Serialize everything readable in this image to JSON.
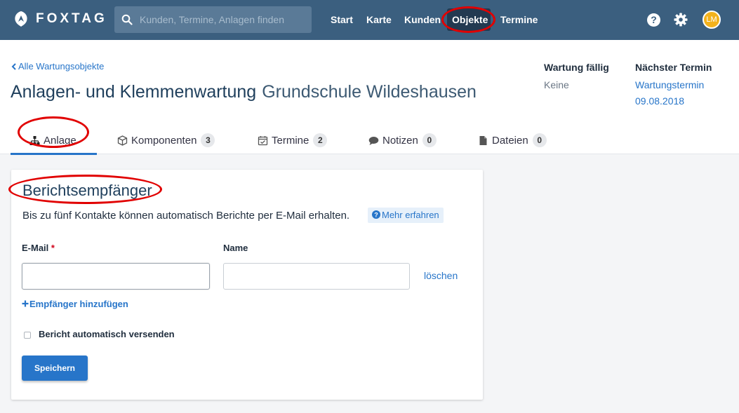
{
  "brand": {
    "name": "FOXTAG"
  },
  "search": {
    "placeholder": "Kunden, Termine, Anlagen finden"
  },
  "nav": {
    "items": [
      {
        "label": "Start"
      },
      {
        "label": "Karte"
      },
      {
        "label": "Kunden"
      },
      {
        "label": "Objekte",
        "active": true
      },
      {
        "label": "Termine"
      }
    ],
    "help_icon": "question-circle-icon",
    "settings_icon": "gear-icon",
    "avatar_initials": "LM"
  },
  "header": {
    "back_link": "Alle Wartungsobjekte",
    "title": "Anlagen- und Klemmenwartung",
    "subtitle": "Grundschule Wildeshausen",
    "wartung": {
      "heading": "Wartung fällig",
      "value": "Keine"
    },
    "termin": {
      "heading": "Nächster Termin",
      "line1": "Wartungstermin",
      "line2": "09.08.2018"
    }
  },
  "tabs": [
    {
      "label": "Anlage",
      "icon": "sitemap-icon",
      "active": true
    },
    {
      "label": "Komponenten",
      "icon": "cube-icon",
      "count": "3"
    },
    {
      "label": "Termine",
      "icon": "calendar-check-icon",
      "count": "2"
    },
    {
      "label": "Notizen",
      "icon": "comment-icon",
      "count": "0"
    },
    {
      "label": "Dateien",
      "icon": "file-icon",
      "count": "0"
    }
  ],
  "card": {
    "title": "Berichtsempfänger",
    "description": "Bis zu fünf Kontakte können automatisch Berichte per E-Mail erhalten.",
    "more_link": "Mehr erfahren",
    "email_label": "E-Mail",
    "required_mark": "*",
    "name_label": "Name",
    "email_value": "",
    "name_value": "",
    "delete_link": "löschen",
    "add_link": "Empfänger hinzufügen",
    "auto_send_label": "Bericht automatisch versenden",
    "auto_send_checked": false,
    "save_label": "Speichern"
  },
  "colors": {
    "navbar": "#3b5f7f",
    "nav_active": "#233a51",
    "accent": "#2775c9",
    "annotation_red": "#e10000",
    "avatar": "#f3b21c"
  }
}
